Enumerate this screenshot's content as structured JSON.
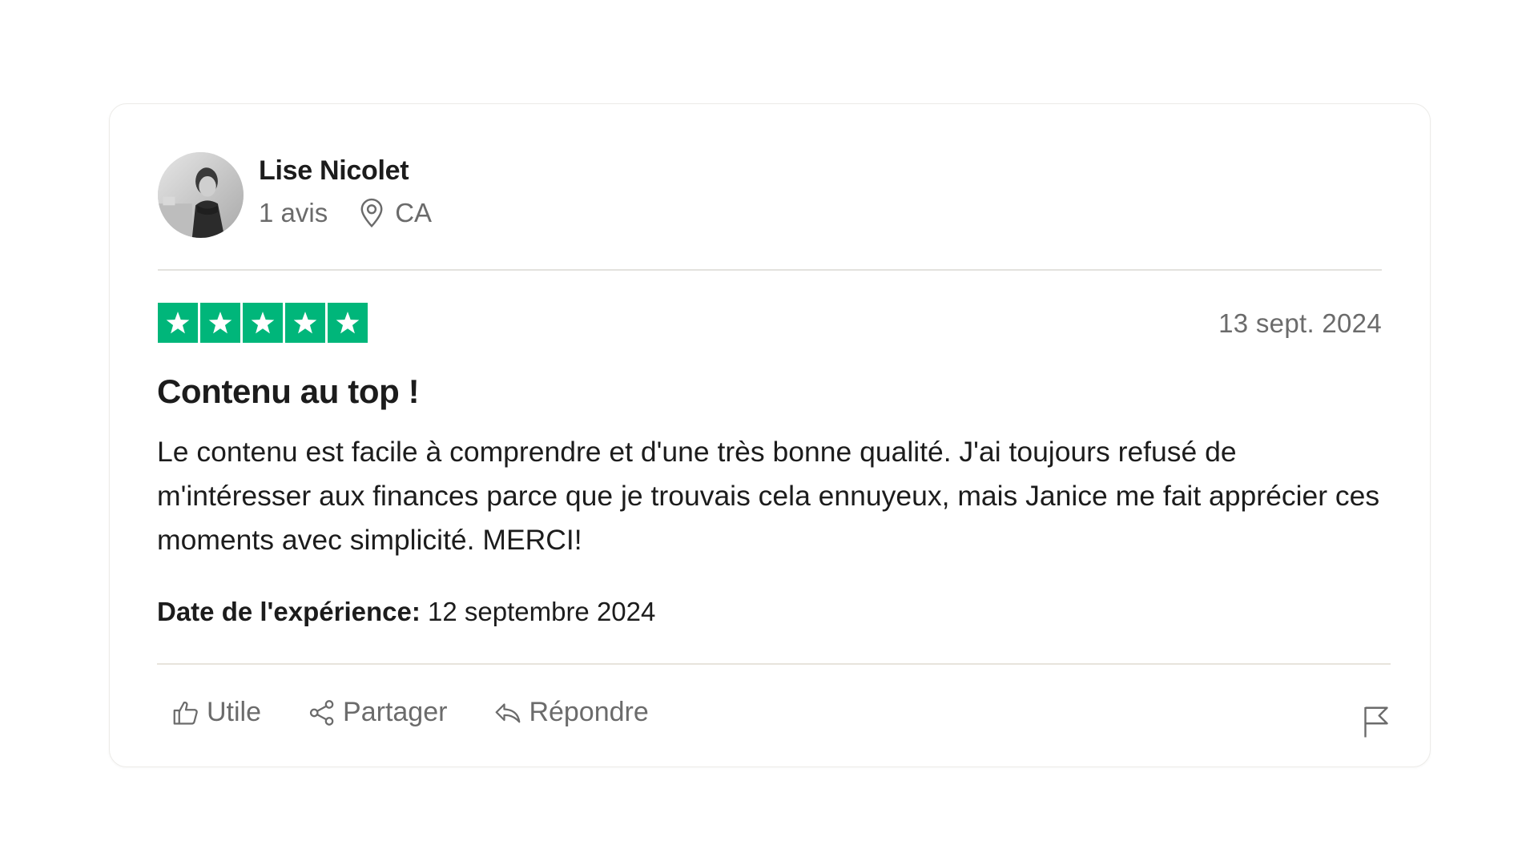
{
  "consumer": {
    "name": "Lise Nicolet",
    "reviews_count": "1 avis",
    "location": "CA"
  },
  "review": {
    "rating": 5,
    "rating_max": 5,
    "date": "13 sept. 2024",
    "title": "Contenu au top !",
    "body": "Le contenu est facile à comprendre et d'une très bonne qualité. J'ai toujours refusé de m'intéresser aux finances parce que je trouvais cela ennuyeux, mais Janice me fait apprécier ces moments avec simplicité. MERCI!",
    "experience_label": "Date de l'expérience:",
    "experience_date": "12 septembre 2024"
  },
  "actions": {
    "useful_label": "Utile",
    "share_label": "Partager",
    "reply_label": "Répondre"
  },
  "icons": {
    "location": "location-pin-icon",
    "useful": "thumbs-up-icon",
    "share": "share-icon",
    "reply": "reply-icon",
    "report": "flag-icon",
    "star": "star-icon"
  },
  "colors": {
    "star_green": "#00b67a",
    "muted_text": "#6b6b6b",
    "primary_text": "#1c1c1c"
  }
}
